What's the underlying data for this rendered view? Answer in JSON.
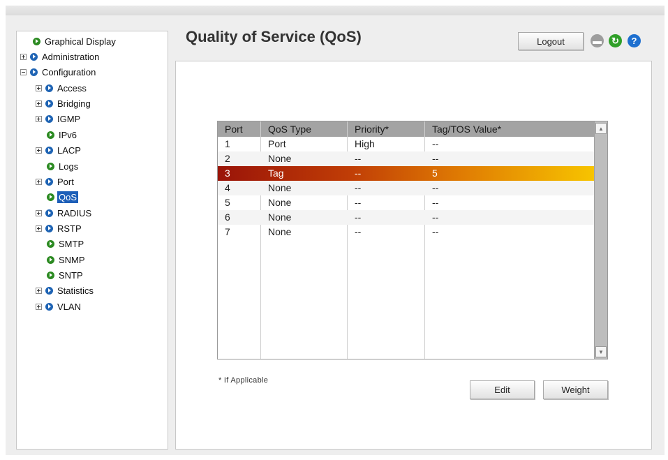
{
  "sidebar": {
    "items": [
      {
        "label": "Graphical Display"
      },
      {
        "label": "Administration"
      },
      {
        "label": "Configuration"
      },
      {
        "label": "Access"
      },
      {
        "label": "Bridging"
      },
      {
        "label": "IGMP"
      },
      {
        "label": "IPv6"
      },
      {
        "label": "LACP"
      },
      {
        "label": "Logs"
      },
      {
        "label": "Port"
      },
      {
        "label": "QoS"
      },
      {
        "label": "RADIUS"
      },
      {
        "label": "RSTP"
      },
      {
        "label": "SMTP"
      },
      {
        "label": "SNMP"
      },
      {
        "label": "SNTP"
      },
      {
        "label": "Statistics"
      },
      {
        "label": "VLAN"
      }
    ],
    "selected": "QoS"
  },
  "header": {
    "title": "Quality of Service (QoS)",
    "logout_label": "Logout",
    "icons": [
      "save-icon",
      "refresh-icon",
      "help-icon"
    ]
  },
  "table": {
    "columns": [
      "Port",
      "QoS Type",
      "Priority*",
      "Tag/TOS Value*"
    ],
    "rows": [
      {
        "port": "1",
        "qos_type": "Port",
        "priority": "High",
        "tag": "--"
      },
      {
        "port": "2",
        "qos_type": "None",
        "priority": "--",
        "tag": "--"
      },
      {
        "port": "3",
        "qos_type": "Tag",
        "priority": "--",
        "tag": "5"
      },
      {
        "port": "4",
        "qos_type": "None",
        "priority": "--",
        "tag": "--"
      },
      {
        "port": "5",
        "qos_type": "None",
        "priority": "--",
        "tag": "--"
      },
      {
        "port": "6",
        "qos_type": "None",
        "priority": "--",
        "tag": "--"
      },
      {
        "port": "7",
        "qos_type": "None",
        "priority": "--",
        "tag": "--"
      }
    ],
    "selected_row": 2,
    "scroll_up": "▲",
    "scroll_down": "▼"
  },
  "footnote": "* If Applicable",
  "actions": {
    "edit_label": "Edit",
    "weight_label": "Weight"
  },
  "icon_glyphs": {
    "save": "▬",
    "refresh": "↻",
    "help": "?"
  },
  "colors": {
    "selected_row_start": "#9a1408",
    "selected_row_end": "#f7c400",
    "tree_selected": "#1d5fb8",
    "bullet_blue": "#1f64b4",
    "bullet_green": "#2b8a21"
  }
}
